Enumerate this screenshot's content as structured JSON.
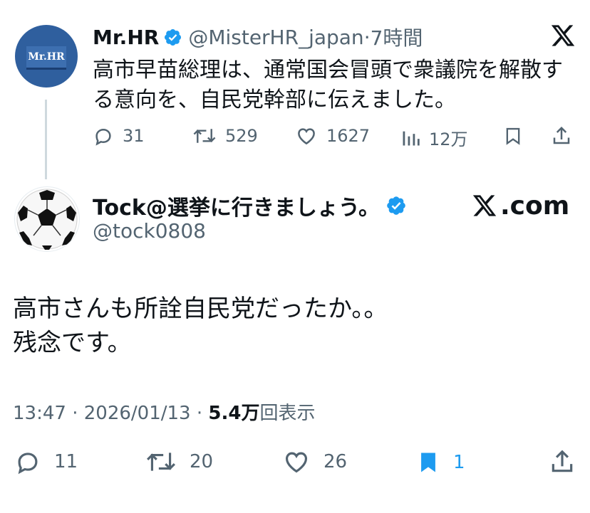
{
  "quoted_tweet": {
    "avatar_text": "Mr.HR",
    "display_name": "Mr.HR",
    "handle": "@MisterHR_japan",
    "separator": "·",
    "time_ago": "7時間",
    "text": "高市早苗総理は、通常国会冒頭で衆議院を解散する意向を、自民党幹部に伝えました。",
    "replies": "31",
    "retweets": "529",
    "likes": "1627",
    "views": "12万"
  },
  "main_tweet": {
    "display_name": "Tock@選挙に行きましょう。",
    "handle": "@tock0808",
    "source_label": ".com",
    "text_line1": "高市さんも所詮自民党だったか。。",
    "text_line2": "残念です。",
    "time": "13:47",
    "meta_sep1": "·",
    "date": "2026/01/13",
    "meta_sep2": "·",
    "views_count": "5.4万",
    "views_label": "回表示",
    "replies": "11",
    "retweets": "20",
    "likes": "26",
    "bookmarks": "1"
  },
  "colors": {
    "accent": "#1d9bf0",
    "muted": "#536471",
    "text": "#0f1419",
    "divider": "#cfd9de"
  },
  "icons": [
    "verified-badge-icon",
    "x-logo-icon",
    "reply-icon",
    "retweet-icon",
    "like-icon",
    "views-icon",
    "bookmark-icon",
    "share-icon",
    "soccer-ball-avatar"
  ]
}
